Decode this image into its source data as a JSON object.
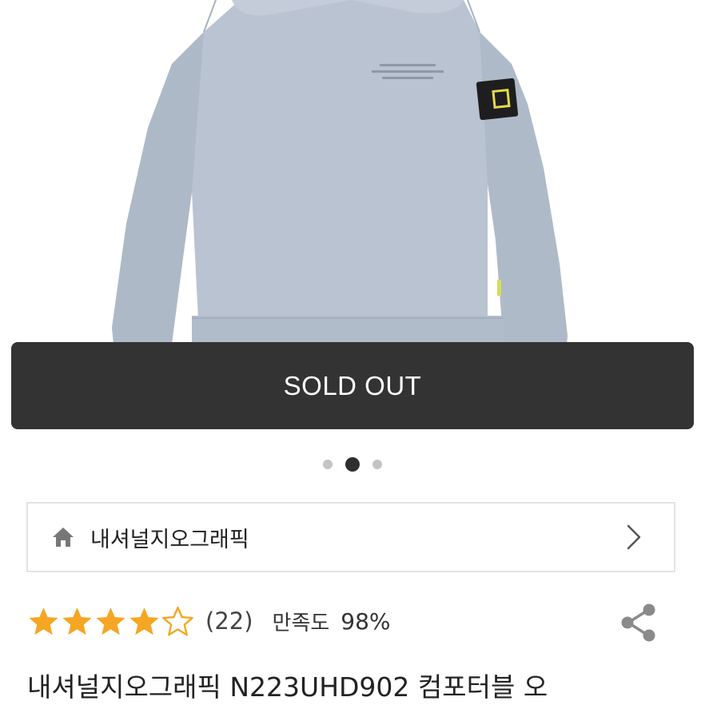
{
  "product": {
    "sold_out_label": "SOLD OUT",
    "image_count": 3,
    "active_image_index": 1,
    "title": "내셔널지오그래픽 N223UHD902 컴포터블 오"
  },
  "brand": {
    "name": "내셔널지오그래픽",
    "home_icon": "home-icon",
    "chevron_icon": "chevron-right-icon"
  },
  "rating": {
    "stars_value": 4.5,
    "stars_max": 5,
    "review_count": "(22)",
    "satisfaction_label": "만족도",
    "satisfaction_value": "98%"
  },
  "share": {
    "icon": "share-icon"
  },
  "colors": {
    "star_fill": "#F5A623",
    "sold_out_bg": "#333333",
    "product_color": "#B5C0CE"
  }
}
